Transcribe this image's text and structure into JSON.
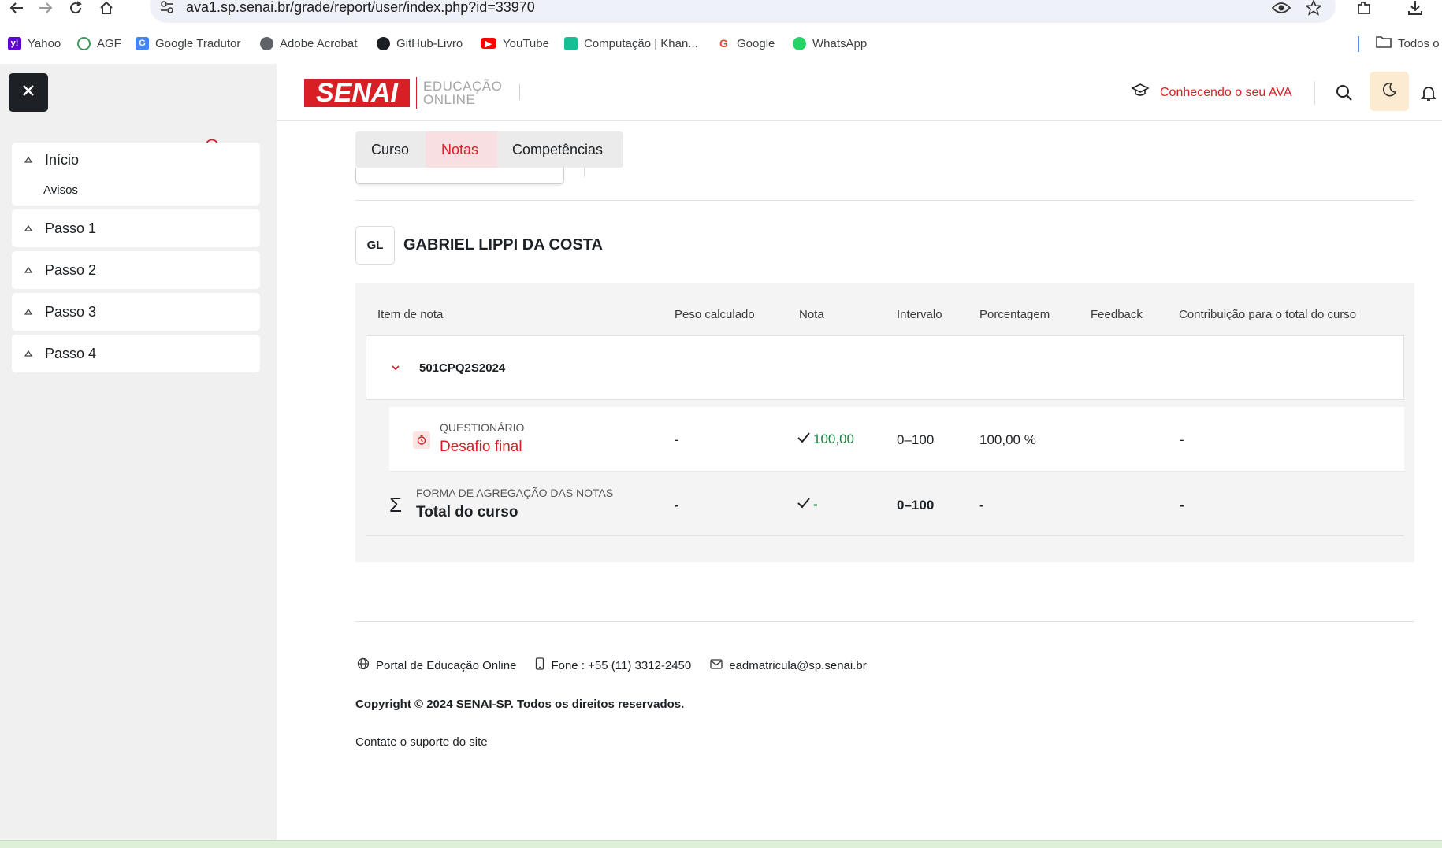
{
  "browser": {
    "url": "ava1.sp.senai.br/grade/report/user/index.php?id=33970",
    "bookmarks": [
      {
        "label": "Yahoo",
        "icon": "yahoo-icon",
        "color": "#6001d2"
      },
      {
        "label": "AGF",
        "icon": "agf-icon",
        "color": "#3b9a5a"
      },
      {
        "label": "Google Tradutor",
        "icon": "google-translate-icon",
        "color": "#4285f4"
      },
      {
        "label": "Adobe Acrobat",
        "icon": "globe-icon",
        "color": "#5f6368"
      },
      {
        "label": "GitHub-Livro",
        "icon": "github-icon",
        "color": "#1b1f23"
      },
      {
        "label": "YouTube",
        "icon": "youtube-icon",
        "color": "#ff0000"
      },
      {
        "label": "Computação | Khan...",
        "icon": "khan-academy-icon",
        "color": "#14bf96"
      },
      {
        "label": "Google",
        "icon": "google-icon",
        "color": "#ea4335"
      },
      {
        "label": "WhatsApp",
        "icon": "whatsapp-icon",
        "color": "#25d366"
      }
    ],
    "all_bookmarks_label": "Todos o"
  },
  "sidebar": {
    "progress": {
      "completed": "4",
      "total": "4",
      "fraction": 1.0
    },
    "sections": [
      {
        "label": "Início",
        "items": [
          "Avisos"
        ]
      },
      {
        "label": "Passo 1",
        "items": []
      },
      {
        "label": "Passo 2",
        "items": []
      },
      {
        "label": "Passo 3",
        "items": []
      },
      {
        "label": "Passo 4",
        "items": []
      }
    ]
  },
  "header": {
    "logo_main": "SENAI",
    "logo_sub_line1": "EDUCAÇÃO",
    "logo_sub_line2": "ONLINE",
    "ava_link": "Conhecendo o seu AVA"
  },
  "tabs": [
    {
      "label": "Curso",
      "active": false
    },
    {
      "label": "Notas",
      "active": true
    },
    {
      "label": "Competências",
      "active": false
    }
  ],
  "user": {
    "initials": "GL",
    "name": "GABRIEL LIPPI DA COSTA"
  },
  "grade_table": {
    "columns": [
      "Item de nota",
      "Peso calculado",
      "Nota",
      "Intervalo",
      "Porcentagem",
      "Feedback",
      "Contribuição para o total do curso"
    ],
    "course_code": "501CPQ2S2024",
    "item": {
      "type": "QUESTIONÁRIO",
      "name": "Desafio final",
      "weight": "-",
      "grade": "100,00",
      "range": "0–100",
      "percentage": "100,00 %",
      "feedback": "",
      "contribution": "-"
    },
    "total": {
      "type": "FORMA DE AGREGAÇÃO DAS NOTAS",
      "name": "Total do curso",
      "weight": "-",
      "grade": "-",
      "range": "0–100",
      "percentage": "-",
      "feedback": "",
      "contribution": "-"
    }
  },
  "footer": {
    "portal": "Portal de Educação Online",
    "phone": "Fone : +55 (11) 3312-2450",
    "email": "eadmatricula@sp.senai.br",
    "copyright": "Copyright © 2024 SENAI-SP. Todos os direitos reservados.",
    "support": "Contate o suporte do site"
  },
  "colors": {
    "brand_red": "#d81f26",
    "grade_green": "#1a7f3c",
    "sidebar_bg": "#f0f0f0"
  }
}
